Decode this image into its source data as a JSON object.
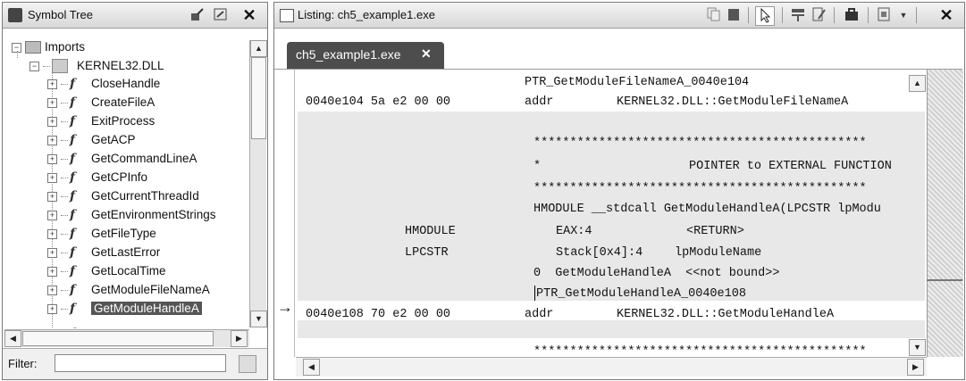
{
  "symbol_tree": {
    "title": "Symbol Tree",
    "close": "✕",
    "imports_label": "Imports",
    "dll_label": "KERNEL32.DLL",
    "functions": [
      "CloseHandle",
      "CreateFileA",
      "ExitProcess",
      "GetACP",
      "GetCommandLineA",
      "GetCPInfo",
      "GetCurrentThreadId",
      "GetEnvironmentStrings",
      "GetFileType",
      "GetLastError",
      "GetLocalTime",
      "GetModuleFileNameA",
      "GetModuleHandleA"
    ],
    "selected_index": 12,
    "filter_label": "Filter:",
    "filter_value": ""
  },
  "listing": {
    "title": "Listing:  ch5_example1.exe",
    "tab_label": "ch5_example1.exe",
    "tab_close": "✕",
    "lines": {
      "l1_label": "PTR_GetModuleFileNameA_0040e104",
      "l2_addr": "0040e104 5a e2 00 00",
      "l2_op": "addr",
      "l2_arg": "KERNEL32.DLL::GetModuleFileNameA",
      "stars1": "**********************************************",
      "star_single": "*",
      "comment": "POINTER to EXTERNAL FUNCTION",
      "stars2": "**********************************************",
      "sig": "HMODULE __stdcall GetModuleHandleA(LPCSTR lpModu",
      "ret_type": "HMODULE",
      "ret_loc": "EAX:4",
      "ret_name": "<RETURN>",
      "p_type": "LPCSTR",
      "p_loc": "Stack[0x4]:4",
      "p_name": "lpModuleName",
      "ord": "0  GetModuleHandleA  <<not bound>>",
      "l2_label": "PTR_GetModuleHandleA_0040e108",
      "l3_addr": "0040e108 70 e2 00 00",
      "l3_op": "addr",
      "l3_arg": "KERNEL32.DLL::GetModuleHandleA",
      "stars3": "**********************************************"
    },
    "cursor_arrow": "→"
  },
  "colors": {
    "band": "#e8e8e8",
    "tab_bg": "#4d4d4d",
    "selection": "#555555"
  }
}
